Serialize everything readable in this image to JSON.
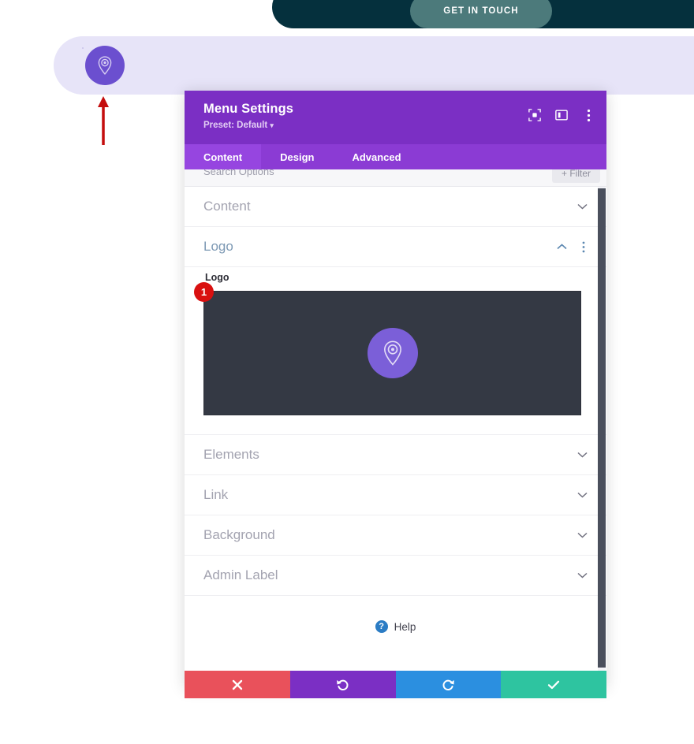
{
  "site": {
    "topbar": {
      "cta_label": "GET IN TOUCH",
      "bar_color": "#05303d",
      "cta_color": "#4c7a7b"
    },
    "logo_bar": {
      "bar_color": "#e7e4f8",
      "logo_icon": "map-pin-icon",
      "logo_circle_color": "#6b4fcf"
    }
  },
  "annotation": {
    "arrow_color": "#c40d0d",
    "step_badge_number": "1",
    "step_badge_color": "#d91010"
  },
  "modal": {
    "title": "Menu Settings",
    "preset_label": "Preset: Default",
    "preset_caret": "▾",
    "header_color": "#7b2fc4",
    "header_icons": [
      {
        "name": "focus-target-icon"
      },
      {
        "name": "panel-layout-icon"
      },
      {
        "name": "vertical-dots-icon"
      }
    ],
    "tabs": [
      {
        "label": "Content",
        "active": true
      },
      {
        "label": "Design",
        "active": false
      },
      {
        "label": "Advanced",
        "active": false
      }
    ],
    "search": {
      "placeholder": "Search Options",
      "filter_label": "Filter",
      "filter_plus": "+"
    },
    "sections": [
      {
        "label": "Content",
        "expanded": false,
        "chevron": "down"
      },
      {
        "label": "Logo",
        "expanded": true,
        "chevron": "up"
      }
    ],
    "logo_panel": {
      "field_label": "Logo",
      "preview_bg": "#343944",
      "preview_icon": "map-pin-icon",
      "preview_circle_color": "#7b5fd8"
    },
    "sections_after": [
      {
        "label": "Elements",
        "expanded": false,
        "chevron": "down"
      },
      {
        "label": "Link",
        "expanded": false,
        "chevron": "down"
      },
      {
        "label": "Background",
        "expanded": false,
        "chevron": "down"
      },
      {
        "label": "Admin Label",
        "expanded": false,
        "chevron": "down"
      }
    ],
    "help": {
      "label": "Help",
      "icon_glyph": "?"
    },
    "actions": [
      {
        "name": "cancel",
        "glyph": "✖",
        "color": "#e9515b"
      },
      {
        "name": "undo",
        "glyph": "↺",
        "color": "#7b2fc4"
      },
      {
        "name": "redo",
        "glyph": "↻",
        "color": "#2b8fe0"
      },
      {
        "name": "save",
        "glyph": "✔",
        "color": "#2ec4a0"
      }
    ]
  }
}
